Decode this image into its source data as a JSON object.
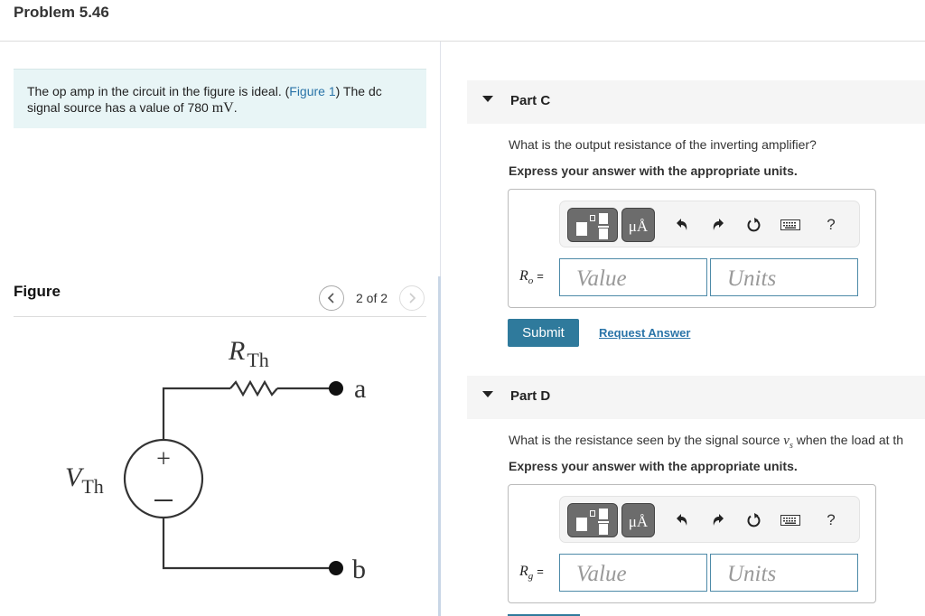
{
  "problem": {
    "title": "Problem 5.46"
  },
  "intro": {
    "text_before": "The op amp in the circuit in the figure is ideal. (",
    "figure_link": "Figure 1",
    "text_after": ") The dc signal source has a value of 780 ",
    "unit": "mV",
    "period": "."
  },
  "figure": {
    "label": "Figure",
    "page_count": "2 of 2",
    "prev_icon": "chevron-left-icon",
    "next_icon": "chevron-right-icon",
    "circuit": {
      "resistor_label": "R",
      "resistor_sub": "Th",
      "source_label": "V",
      "source_sub": "Th",
      "plus": "+",
      "minus": "−",
      "terminal_a": "a",
      "terminal_b": "b"
    }
  },
  "toolbar": {
    "templates_icon": "fraction-template-icon",
    "units_label": "μÅ",
    "undo_icon": "undo-icon",
    "redo_icon": "redo-icon",
    "reset_icon": "reset-icon",
    "keyboard_icon": "keyboard-icon",
    "help_label": "?"
  },
  "parts": [
    {
      "title": "Part C",
      "question": "What is the output resistance of the inverting amplifier?",
      "instruction": "Express your answer with the appropriate units.",
      "var_symbol": "R",
      "var_sub": "o",
      "equals": "=",
      "value_placeholder": "Value",
      "units_placeholder": "Units",
      "submit_label": "Submit",
      "request_label": "Request Answer"
    },
    {
      "title": "Part D",
      "question_before": "What is the resistance seen by the signal source ",
      "question_math": "v",
      "question_math_sub": "s",
      "question_after": " when the load at th",
      "instruction": "Express your answer with the appropriate units.",
      "var_symbol": "R",
      "var_sub": "g",
      "equals": "=",
      "value_placeholder": "Value",
      "units_placeholder": "Units"
    }
  ],
  "colors": {
    "accent": "#2f7a9c",
    "link": "#2a74a8",
    "intro_bg": "#e8f5f6",
    "part_header_bg": "#f5f5f5",
    "toolbar_button": "#6c6c6c"
  }
}
